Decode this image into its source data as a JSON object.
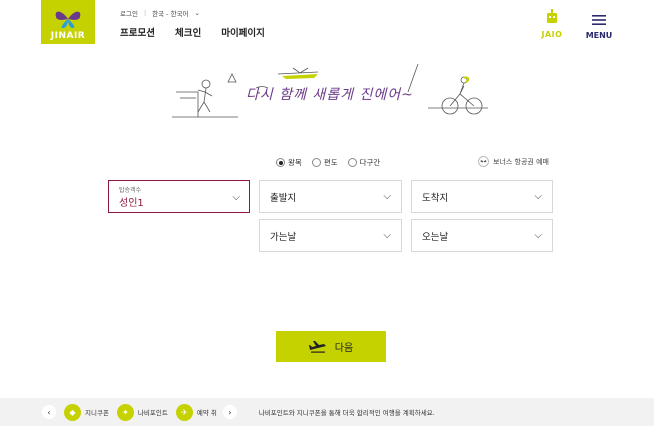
{
  "brand": {
    "logo_text": "JINAIR",
    "accent": "#c5d200",
    "dark_accent": "#8b1a3a",
    "banner_text": "다시 함께 새롭게 진에어~"
  },
  "util": {
    "login": "로그인",
    "language": "한국 - 한국어"
  },
  "gnb": {
    "items": [
      "프로모션",
      "체크인",
      "마이페이지"
    ]
  },
  "header_right": {
    "jaio": "JAIO",
    "menu": "MENU"
  },
  "trip_type": {
    "options": [
      "왕복",
      "편도",
      "다구간"
    ],
    "selected": "왕복"
  },
  "bonus": {
    "label": "보너스 항공권 예매"
  },
  "search": {
    "passenger_label": "탑승객수",
    "passenger_value": "성인1",
    "departure": "출발지",
    "arrival": "도착지",
    "depart_date": "가는날",
    "return_date": "오는날"
  },
  "next_button": "다음",
  "bottom_bar": {
    "items": [
      "지니쿠폰",
      "나비포인트",
      "예약 취"
    ],
    "message": "나비포인트와 지니쿠폰을 통해 더욱 합리적인 여행을 계획하세요."
  }
}
